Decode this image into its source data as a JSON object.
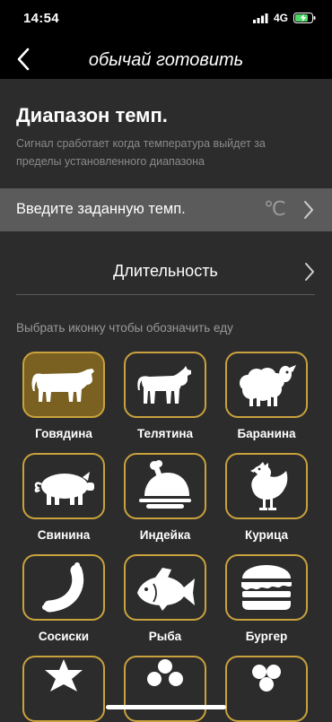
{
  "status": {
    "time": "14:54",
    "network": "4G"
  },
  "nav": {
    "title": "обычай готовить"
  },
  "range": {
    "title": "Диапазон темп.",
    "description": "Сигнал сработает когда температура выйдет за пределы установленного диапазона"
  },
  "temp": {
    "label": "Введите заданную темп.",
    "unit": "℃"
  },
  "duration": {
    "label": "Длительность"
  },
  "icons": {
    "caption": "Выбрать иконку чтобы обозначить еду",
    "items": [
      {
        "label": "Говядина",
        "icon": "cow-icon",
        "selected": true
      },
      {
        "label": "Телятина",
        "icon": "calf-icon",
        "selected": false
      },
      {
        "label": "Баранина",
        "icon": "sheep-icon",
        "selected": false
      },
      {
        "label": "Свинина",
        "icon": "pig-icon",
        "selected": false
      },
      {
        "label": "Индейка",
        "icon": "roast-turkey-icon",
        "selected": false
      },
      {
        "label": "Курица",
        "icon": "chicken-icon",
        "selected": false
      },
      {
        "label": "Сосиски",
        "icon": "sausage-icon",
        "selected": false
      },
      {
        "label": "Рыба",
        "icon": "fish-icon",
        "selected": false
      },
      {
        "label": "Бургер",
        "icon": "burger-icon",
        "selected": false
      }
    ]
  },
  "colors": {
    "accent": "#c9a23e",
    "selected_fill": "#7a6122",
    "background": "#2c2c2c",
    "battery": "#4cd964"
  }
}
